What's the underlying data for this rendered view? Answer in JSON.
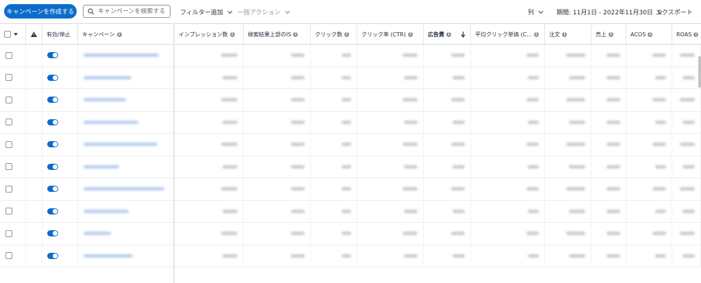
{
  "toolbar": {
    "create_label": "キャンペーンを作成する",
    "search_placeholder": "キャンペーンを検索する",
    "filter_label": "フィルター追加",
    "bulk_label": "一括アクション",
    "columns_label": "列",
    "period_label": "期間: 11月1日 - 2022年11月30日",
    "export_label": "エクスポート"
  },
  "table": {
    "headers": {
      "active": "有効/停止",
      "campaign": "キャンペーン",
      "impressions": "インプレッション数",
      "top_is": "検索結果上部のIS",
      "clicks": "クリック数",
      "ctr": "クリック率 (CTR)",
      "spend": "広告費",
      "cpc": "平均クリック単価 (C...",
      "orders": "注文",
      "sales": "売上",
      "acos": "ACOS",
      "roas": "ROAS"
    },
    "row_count": 10,
    "toggle_states": [
      true,
      true,
      true,
      true,
      true,
      true,
      true,
      true,
      true,
      true
    ]
  },
  "colors": {
    "accent": "#0b6ccb",
    "border": "#d5d9d9",
    "text": "#232f3e"
  },
  "icons": {
    "search": "search-icon",
    "chevron": "chevron-down-icon",
    "warning": "warning-icon",
    "sort": "arrow-down-icon",
    "info": "info-icon"
  }
}
